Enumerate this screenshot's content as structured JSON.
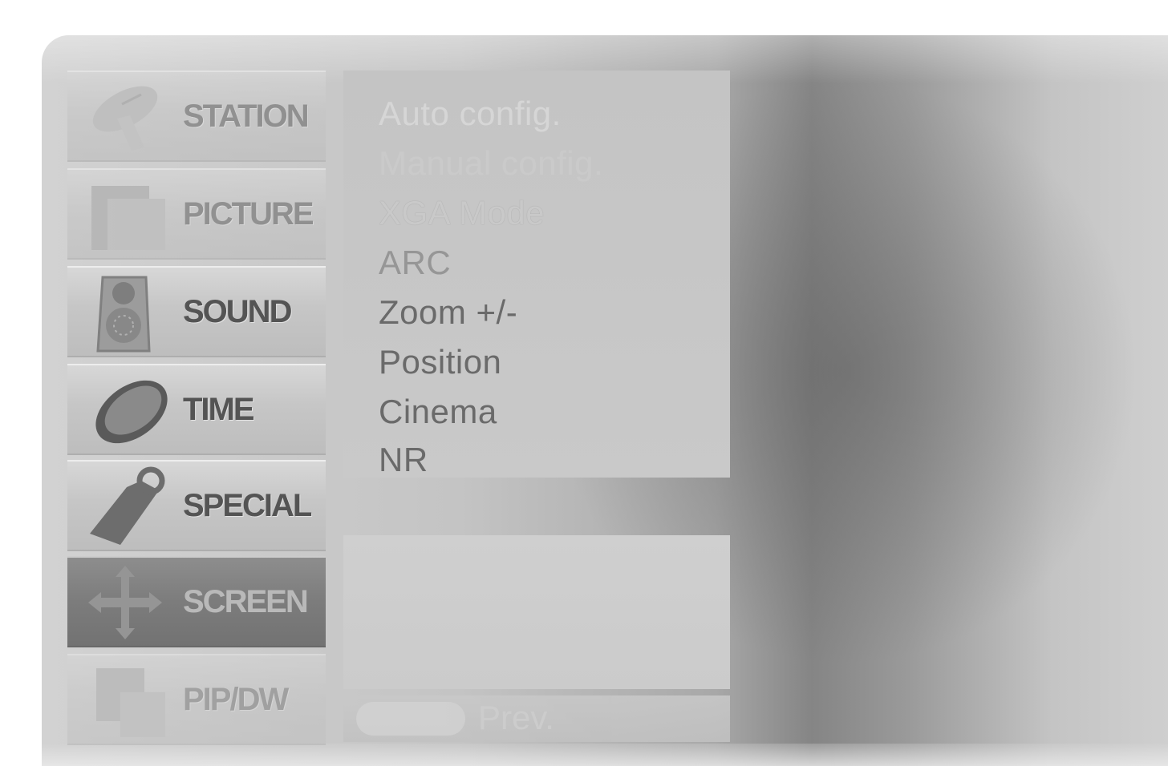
{
  "menu": {
    "items": [
      {
        "label": "STATION",
        "icon": "satellite-dish-icon"
      },
      {
        "label": "PICTURE",
        "icon": "monitor-icon"
      },
      {
        "label": "SOUND",
        "icon": "speaker-icon"
      },
      {
        "label": "TIME",
        "icon": "clock-icon"
      },
      {
        "label": "SPECIAL",
        "icon": "tag-icon"
      },
      {
        "label": "SCREEN",
        "icon": "move-arrows-icon"
      },
      {
        "label": "PIP/DW",
        "icon": "pip-window-icon"
      }
    ],
    "selected": "SCREEN"
  },
  "submenu": {
    "items": [
      "Auto config.",
      "Manual config.",
      "XGA Mode",
      "ARC",
      "Zoom +/-",
      "Position",
      "Cinema",
      "NR"
    ]
  },
  "footer": {
    "prev_label": "Prev."
  },
  "colors": {
    "panel": "#c4c4c4",
    "selected_tile": "#7c7c7c",
    "text": "#6a6a6a"
  }
}
